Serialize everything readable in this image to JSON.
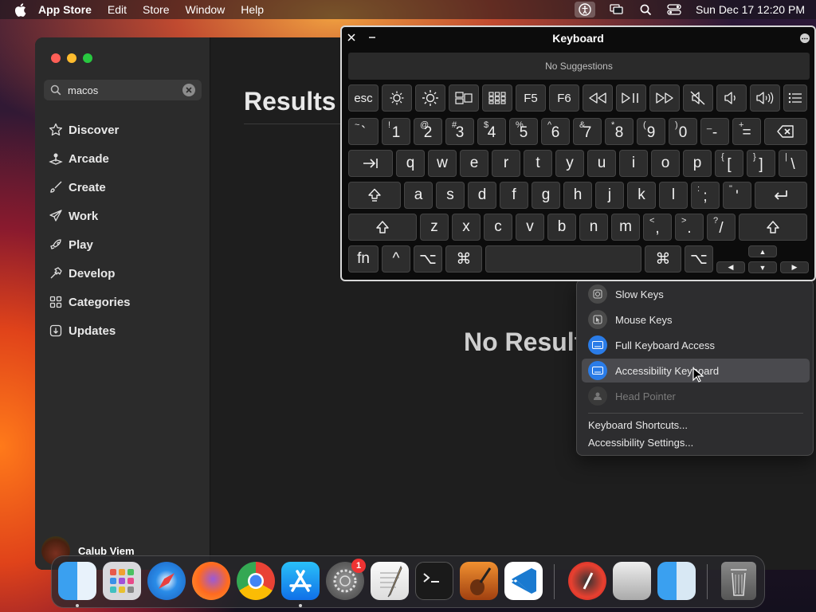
{
  "menubar": {
    "app_name": "App Store",
    "items": [
      "Edit",
      "Store",
      "Window",
      "Help"
    ],
    "datetime": "Sun Dec 17  12:20 PM"
  },
  "appstore": {
    "search_value": "macos",
    "nav": [
      {
        "label": "Discover",
        "icon": "star-icon"
      },
      {
        "label": "Arcade",
        "icon": "joystick-icon"
      },
      {
        "label": "Create",
        "icon": "brush-icon"
      },
      {
        "label": "Work",
        "icon": "paperplane-icon"
      },
      {
        "label": "Play",
        "icon": "rocket-icon"
      },
      {
        "label": "Develop",
        "icon": "hammer-icon"
      },
      {
        "label": "Categories",
        "icon": "grid-icon"
      },
      {
        "label": "Updates",
        "icon": "download-icon"
      }
    ],
    "user_name": "Calub Viem",
    "results_title": "Results",
    "no_results": "No Results"
  },
  "keyboard": {
    "title": "Keyboard",
    "suggestions": "No Suggestions",
    "rows": {
      "fn_row": [
        "esc",
        "brightness-down-icon",
        "brightness-up-icon",
        "mission-control-icon",
        "launchpad-icon",
        "F5",
        "F6",
        "rewind-icon",
        "play-pause-icon",
        "fast-forward-icon",
        "mute-icon",
        "volume-down-icon",
        "volume-up-icon",
        "options-icon"
      ],
      "number_row": [
        {
          "main": "`",
          "sub": "~"
        },
        {
          "main": "1",
          "sub": "!"
        },
        {
          "main": "2",
          "sub": "@"
        },
        {
          "main": "3",
          "sub": "#"
        },
        {
          "main": "4",
          "sub": "$"
        },
        {
          "main": "5",
          "sub": "%"
        },
        {
          "main": "6",
          "sub": "^"
        },
        {
          "main": "7",
          "sub": "&"
        },
        {
          "main": "8",
          "sub": "*"
        },
        {
          "main": "9",
          "sub": "("
        },
        {
          "main": "0",
          "sub": ")"
        },
        {
          "main": "-",
          "sub": "_"
        },
        {
          "main": "=",
          "sub": "+"
        }
      ],
      "q_row": [
        "q",
        "w",
        "e",
        "r",
        "t",
        "y",
        "u",
        "i",
        "o",
        "p"
      ],
      "q_row_extra": [
        {
          "main": "[",
          "sub": "{"
        },
        {
          "main": "]",
          "sub": "}"
        },
        {
          "main": "\\",
          "sub": "|"
        }
      ],
      "a_row": [
        "a",
        "s",
        "d",
        "f",
        "g",
        "h",
        "j",
        "k",
        "l"
      ],
      "a_row_extra": [
        {
          "main": ";",
          "sub": ":"
        },
        {
          "main": "'",
          "sub": "\""
        }
      ],
      "z_row": [
        "z",
        "x",
        "c",
        "v",
        "b",
        "n",
        "m"
      ],
      "z_row_extra": [
        {
          "main": ",",
          "sub": "<"
        },
        {
          "main": ".",
          "sub": ">"
        },
        {
          "main": "/",
          "sub": "?"
        }
      ],
      "bottom": {
        "fn": "fn",
        "ctrl": "^",
        "opt": "⌥",
        "cmd": "⌘"
      }
    }
  },
  "accessibility_menu": {
    "items": [
      {
        "label": "Slow Keys",
        "icon": "slow-keys-icon"
      },
      {
        "label": "Mouse Keys",
        "icon": "mouse-keys-icon"
      },
      {
        "label": "Full Keyboard Access",
        "icon": "keyboard-access-icon"
      },
      {
        "label": "Accessibility Keyboard",
        "icon": "accessibility-keyboard-icon"
      },
      {
        "label": "Head Pointer",
        "icon": "head-pointer-icon"
      }
    ],
    "links": [
      "Keyboard Shortcuts...",
      "Accessibility Settings..."
    ]
  },
  "dock": {
    "apps": [
      "Finder",
      "Launchpad",
      "Safari",
      "Firefox",
      "Chrome",
      "App Store",
      "System Settings",
      "TextEdit",
      "Terminal",
      "GarageBand",
      "VS Code",
      "Directory Utility",
      "Migration Assistant",
      "Finder Alt",
      "Trash"
    ],
    "settings_badge": "1"
  }
}
